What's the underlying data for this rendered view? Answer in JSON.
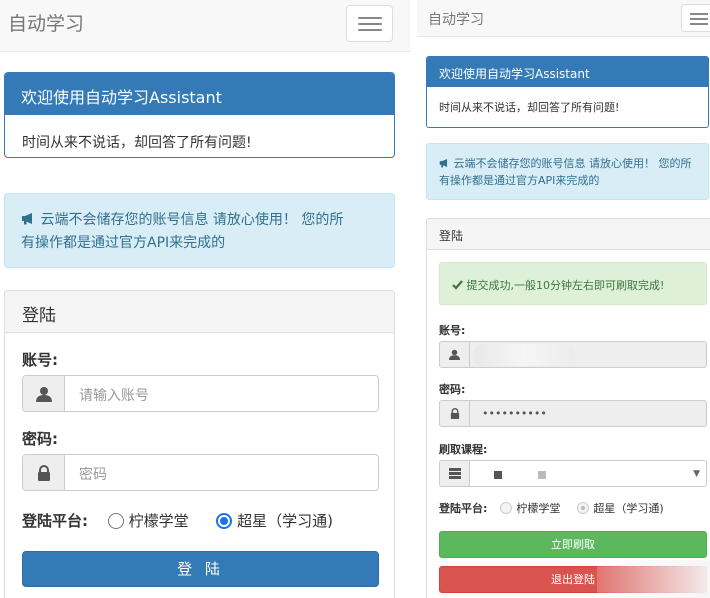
{
  "left": {
    "navbar": {
      "brand": "自动学习"
    },
    "welcome": {
      "title": "欢迎使用自动学习Assistant",
      "body": "时间从来不说话，却回答了所有问题!"
    },
    "notice": {
      "line1": "云端不会储存您的账号信息 请放心使用！ 您的所",
      "line2": "有操作都是通过官方API来完成的"
    },
    "login": {
      "title": "登陆",
      "account_label": "账号:",
      "account_placeholder": "请输入账号",
      "password_label": "密码:",
      "password_placeholder": "密码",
      "platform_label": "登陆平台:",
      "platform_options": [
        "柠檬学堂",
        "超星（学习通)"
      ],
      "platform_selected": "超星（学习通)",
      "submit_label": "登 陆"
    }
  },
  "right": {
    "navbar": {
      "brand": "自动学习"
    },
    "welcome": {
      "title": "欢迎使用自动学习Assistant",
      "body": "时间从来不说话，却回答了所有问题!"
    },
    "notice": {
      "line1": "云端不会储存您的账号信息 请放心使用！ 您的所",
      "line2": "有操作都是通过官方API来完成的"
    },
    "login": {
      "title": "登陆",
      "success_message": "提交成功,一般10分钟左右即可刷取完成!",
      "account_label": "账号:",
      "password_label": "密码:",
      "password_value": "••••••••••",
      "course_label": "刷取课程:",
      "platform_label": "登陆平台:",
      "platform_options": [
        "柠檬学堂",
        "超星（学习通)"
      ],
      "start_button": "立即刷取",
      "logout_button": "退出登陆"
    }
  },
  "colors": {
    "primary": "#337ab7",
    "info_bg": "#d9edf7",
    "info_text": "#31708f",
    "success_bg": "#dff0d8",
    "success_text": "#3c763d",
    "green_button": "#5cb85c",
    "red_button": "#d9534f"
  },
  "icons": [
    "hamburger-menu-icon",
    "bullhorn-icon",
    "user-icon",
    "lock-icon",
    "list-icon",
    "check-icon",
    "chevron-down-icon"
  ]
}
